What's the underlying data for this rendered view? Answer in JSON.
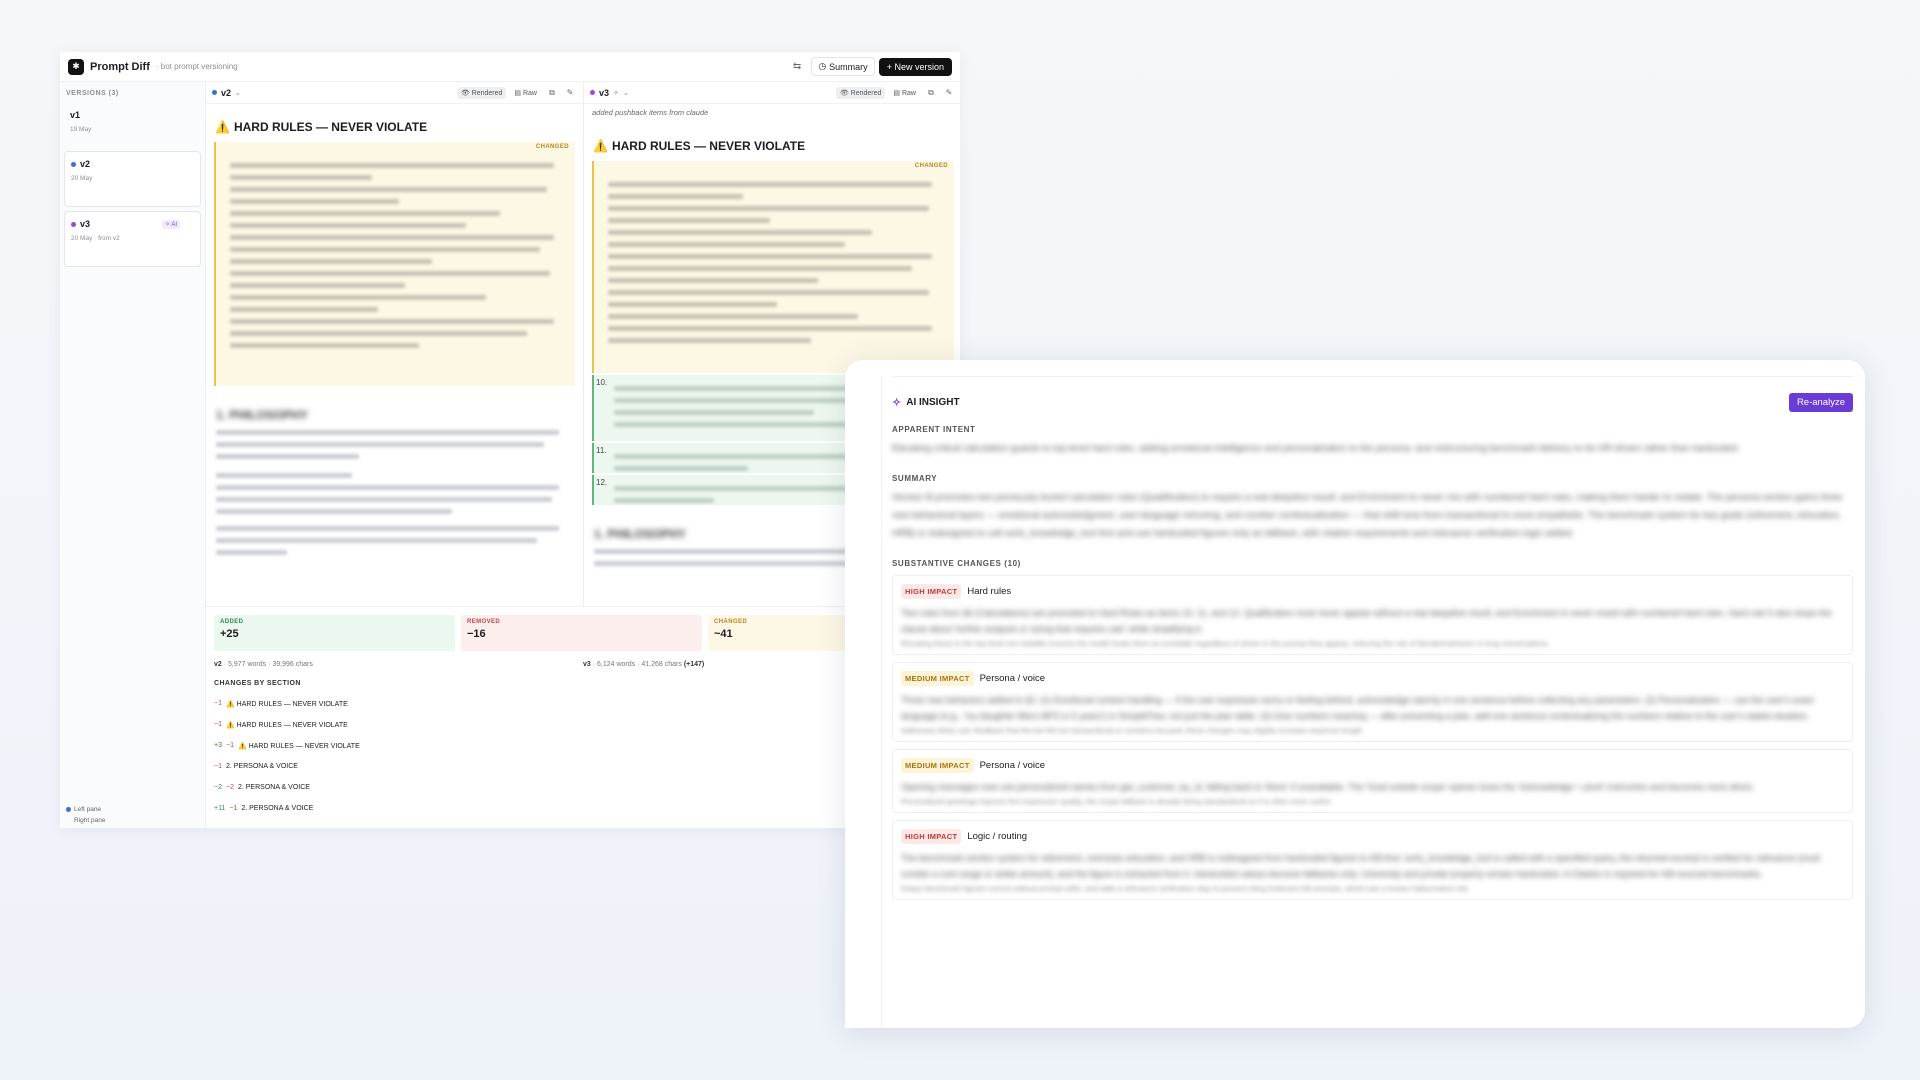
{
  "app": {
    "title": "Prompt Diff",
    "subtitle": "· bot prompt versioning",
    "summary_label": "Summary",
    "new_version_label": "New version"
  },
  "sidebar": {
    "heading": "VERSIONS (3)",
    "versions": [
      {
        "name": "v1",
        "date": "19 May"
      },
      {
        "name": "v2",
        "date": "20 May"
      },
      {
        "name": "v3",
        "date": "20 May · from v2",
        "badge": "AI"
      }
    ],
    "footer": {
      "left": "Left pane",
      "right": "Right pane"
    }
  },
  "left_pane": {
    "version": "v2",
    "rendered_label": "Rendered",
    "raw_label": "Raw",
    "section_title": "HARD RULES — NEVER VIOLATE",
    "changed_tag": "CHANGED",
    "blurred_heading": "1. PHILOSOPHY"
  },
  "right_pane": {
    "version": "v3",
    "rendered_label": "Rendered",
    "raw_label": "Raw",
    "note": "added pushback items from claude",
    "section_title": "HARD RULES — NEVER VIOLATE",
    "changed_tag": "CHANGED",
    "numbers": [
      "10.",
      "11.",
      "12."
    ],
    "blurred_heading": "1. PHILOSOPHY"
  },
  "stats": {
    "added": {
      "label": "ADDED",
      "value": "+25"
    },
    "removed": {
      "label": "REMOVED",
      "value": "−16"
    },
    "changed": {
      "label": "CHANGED",
      "value": "~41"
    },
    "left_meta": {
      "ver": "v2",
      "text": "· 5,977 words · 39,996 chars"
    },
    "right_meta": {
      "ver": "v3",
      "text": "· 6,124 words · 41,268 chars",
      "delta": "(+147)"
    },
    "changes_heading": "CHANGES BY SECTION",
    "sections": [
      {
        "add": "",
        "rem": "−1",
        "name": "⚠️ HARD RULES — NEVER VIOLATE"
      },
      {
        "add": "",
        "rem": "−1",
        "name": "⚠️ HARD RULES — NEVER VIOLATE"
      },
      {
        "add": "+3",
        "rem": "−1",
        "name": "⚠️ HARD RULES — NEVER VIOLATE"
      },
      {
        "add": "",
        "rem": "−1",
        "name": "2. PERSONA & VOICE"
      },
      {
        "add": "−2",
        "rem": "−2",
        "name": "2. PERSONA & VOICE"
      },
      {
        "add": "+11",
        "rem": "−1",
        "name": "2. PERSONA & VOICE"
      }
    ]
  },
  "insight": {
    "title": "AI INSIGHT",
    "reanalyze_label": "Re-analyze",
    "intent_label": "APPARENT INTENT",
    "intent_text": "Elevating critical calculation guards to top-level hard rules, adding emotional intelligence and personalization to the persona, and restructuring benchmark delivery to be HR-driven rather than hardcoded.",
    "summary_label": "SUMMARY",
    "summary_text": "Version B promotes two previously buried calculation rules (Qualification) to require a real deepdive result, and Enrichment to never mix with numbered hard rules, making them harder to violate. The persona section gains three new behavioral layers — emotional acknowledgment, user-language mirroring, and number contextualization — that shift tone from transactional to more empathetic. The benchmark system for key goals (retirement, education, HRB) is redesigned to call sorts_knowledge_tool first and use hardcoded figures only as fallback, with citation requirements and relevance verification logic added.",
    "changes_label": "SUBSTANTIVE CHANGES (10)",
    "changes": [
      {
        "impact": "HIGH IMPACT",
        "level": "high",
        "area": "Hard rules",
        "body": "Two rules from §6 (Calculations) are promoted to Hard Rules as items 10, 11, and 12. Qualification must never appear without a real deepdive result, and Enrichment is never mixed with numbered hard rules. Hard rule 5 also drops the clause about 'further analysis or sizing that requires calc' while simplifying it.",
        "note": "Elevating these to the top-level non-violable ensures the model treats them as inviolable regardless of where in the prompt they appear, reducing the risk of blended behavior in long conversations."
      },
      {
        "impact": "MEDIUM IMPACT",
        "level": "medium",
        "area": "Persona / voice",
        "body": "Three new behaviors added to §2: (1) Emotional context handling — if the user expresses worry or feeling behind, acknowledge warmly in one sentence before collecting any parameters. (2) Personalization — use the user's exact language (e.g., 'my daughter Mia's MFS in 5 years') in SimpleFlow, not just the plan table. (3) Give numbers meaning — after presenting a plan, add one sentence contextualizing the numbers relative to the user's stated situation.",
        "note": "Addresses likely user feedback that the bot felt too transactional or numbers-focused; these changes may slightly increase response length."
      },
      {
        "impact": "MEDIUM IMPACT",
        "level": "medium",
        "area": "Persona / voice",
        "body": "Opening messages now use personalized names from get_customer_by_id, falling back to 'there' if unavailable. The 'Goal outside scope' opener loses the 'Acknowledge + pivot' instruction and becomes more direct.",
        "note": "Personalized greetings improve first impression quality; the scope fallback is already being standardized so it is often more useful."
      },
      {
        "impact": "HIGH IMPACT",
        "level": "high",
        "area": "Logic / routing",
        "body": "The benchmark section system for retirement, overseas education, and HRB is redesigned from hardcoded figures to KB-first: sorts_knowledge_tool is called with a specified query, the returned excerpt is verified for relevance (must contain a cost range or dollar amount), and the figure is extracted from it. Hardcoded values become fallbacks only. University and private property remain hardcoded. A Citation is required for KB-sourced benchmarks.",
        "note": "Keeps benchmark figures current without prompt edits, and adds a relevance verification step to prevent citing irrelevant KB excerpts, which was a known hallucination risk."
      }
    ]
  }
}
